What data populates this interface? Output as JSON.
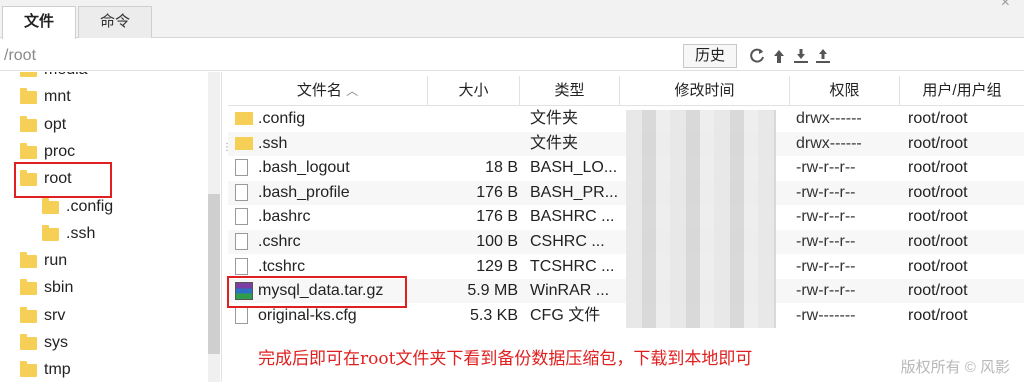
{
  "tabs": {
    "files": "文件",
    "command": "命令"
  },
  "path": {
    "value": "/root",
    "history": "历史"
  },
  "tree": [
    {
      "label": "media",
      "indent": 0
    },
    {
      "label": "mnt",
      "indent": 0
    },
    {
      "label": "opt",
      "indent": 0
    },
    {
      "label": "proc",
      "indent": 0
    },
    {
      "label": "root",
      "indent": 0
    },
    {
      "label": ".config",
      "indent": 1
    },
    {
      "label": ".ssh",
      "indent": 1
    },
    {
      "label": "run",
      "indent": 0
    },
    {
      "label": "sbin",
      "indent": 0
    },
    {
      "label": "srv",
      "indent": 0
    },
    {
      "label": "sys",
      "indent": 0
    },
    {
      "label": "tmp",
      "indent": 0
    }
  ],
  "columns": {
    "name": "文件名",
    "size": "大小",
    "type": "类型",
    "mtime": "修改时间",
    "perm": "权限",
    "owner": "用户/用户组"
  },
  "files": [
    {
      "name": ".config",
      "size": "",
      "type": "文件夹",
      "perm": "drwx------",
      "owner": "root/root",
      "icon": "folder-icon"
    },
    {
      "name": ".ssh",
      "size": "",
      "type": "文件夹",
      "perm": "drwx------",
      "owner": "root/root",
      "icon": "folder-icon"
    },
    {
      "name": ".bash_logout",
      "size": "18 B",
      "type": "BASH_LO...",
      "perm": "-rw-r--r--",
      "owner": "root/root",
      "icon": "file-icon"
    },
    {
      "name": ".bash_profile",
      "size": "176 B",
      "type": "BASH_PR...",
      "perm": "-rw-r--r--",
      "owner": "root/root",
      "icon": "file-icon"
    },
    {
      "name": ".bashrc",
      "size": "176 B",
      "type": "BASHRC ...",
      "perm": "-rw-r--r--",
      "owner": "root/root",
      "icon": "file-icon"
    },
    {
      "name": ".cshrc",
      "size": "100 B",
      "type": "CSHRC ...",
      "perm": "-rw-r--r--",
      "owner": "root/root",
      "icon": "file-icon"
    },
    {
      "name": ".tcshrc",
      "size": "129 B",
      "type": "TCSHRC ...",
      "perm": "-rw-r--r--",
      "owner": "root/root",
      "icon": "file-icon"
    },
    {
      "name": "mysql_data.tar.gz",
      "size": "5.9 MB",
      "type": "WinRAR ...",
      "perm": "-rw-r--r--",
      "owner": "root/root",
      "icon": "archive-icon"
    },
    {
      "name": "original-ks.cfg",
      "size": "5.3 KB",
      "type": "CFG 文件",
      "perm": "-rw-------",
      "owner": "root/root",
      "icon": "file-icon"
    }
  ],
  "note": "完成后即可在root文件夹下看到备份数据压缩包，下载到本地即可",
  "watermark": "版权所有 © 风影",
  "colors": {
    "highlight": "#e02020",
    "folder": "#f6cf57"
  }
}
